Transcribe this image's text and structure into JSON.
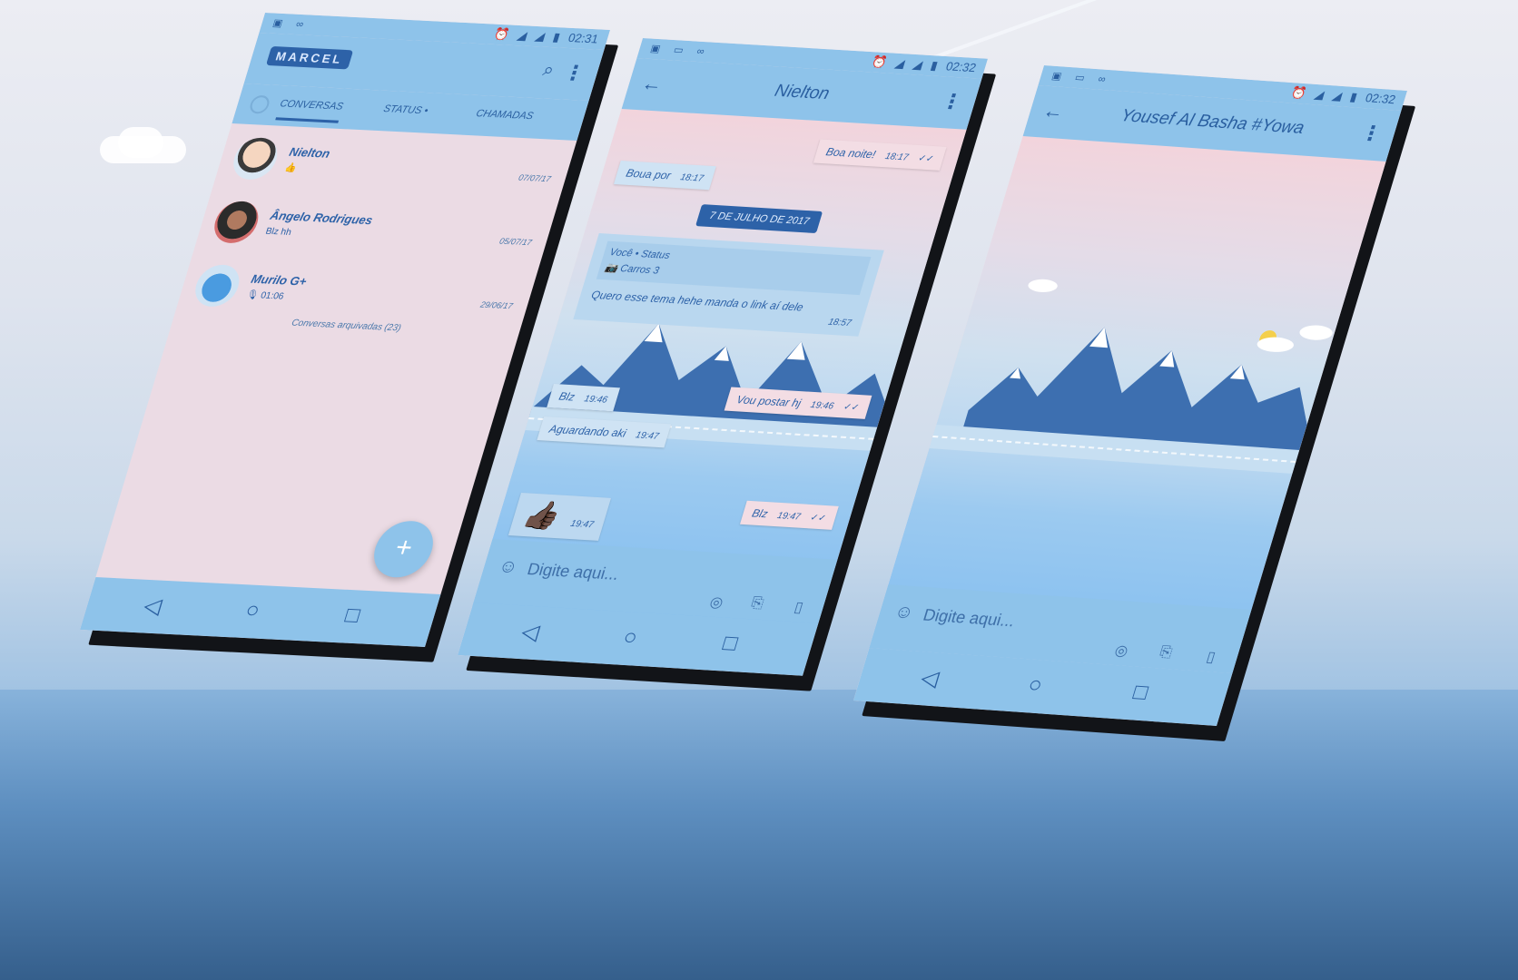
{
  "phone1": {
    "status": {
      "time": "02:31"
    },
    "logo": "MARCEL",
    "tabs": [
      {
        "label": "CONVERSAS"
      },
      {
        "label": "STATUS •"
      },
      {
        "label": "CHAMADAS"
      }
    ],
    "chats": [
      {
        "name": "Nielton",
        "preview": "👍",
        "date": "07/07/17"
      },
      {
        "name": "Ângelo Rodrigues",
        "preview": "Blz hh",
        "date": "05/07/17"
      },
      {
        "name": "Murilo G+",
        "preview": "🎙 01:06",
        "date": "29/06/17"
      }
    ],
    "archived": "Conversas arquivadas (23)",
    "fab": "+"
  },
  "phone2": {
    "status": {
      "time": "02:32"
    },
    "title": "Nielton",
    "messages": [
      {
        "text": "Boa noite!",
        "time": "18:17",
        "ticks": "✓✓"
      },
      {
        "text": "Boua por",
        "time": "18:17"
      },
      {
        "quote_source": "Você • Status",
        "quote_sub": "📷 Carros 3",
        "text": "Quero esse tema hehe manda o link aí dele",
        "time": "18:57"
      },
      {
        "text": "Vou postar hj",
        "time": "19:46",
        "ticks": "✓✓"
      },
      {
        "text": "Blz",
        "time": "19:46"
      },
      {
        "text": "Aguardando aki",
        "time": "19:47"
      },
      {
        "text": "Blz",
        "time": "19:47",
        "ticks": "✓✓"
      },
      {
        "text": "👍🏿",
        "time": "19:47"
      }
    ],
    "date_separator": "7 DE JULHO DE 2017",
    "input_placeholder": "Digite aqui..."
  },
  "phone3": {
    "status": {
      "time": "02:32"
    },
    "title": "Yousef Al Basha #Yowa",
    "input_placeholder": "Digite aqui..."
  },
  "colors": {
    "appbar": "#8ec3ea",
    "accent": "#2d62a8",
    "chat_bg": "#ebdbe4"
  }
}
